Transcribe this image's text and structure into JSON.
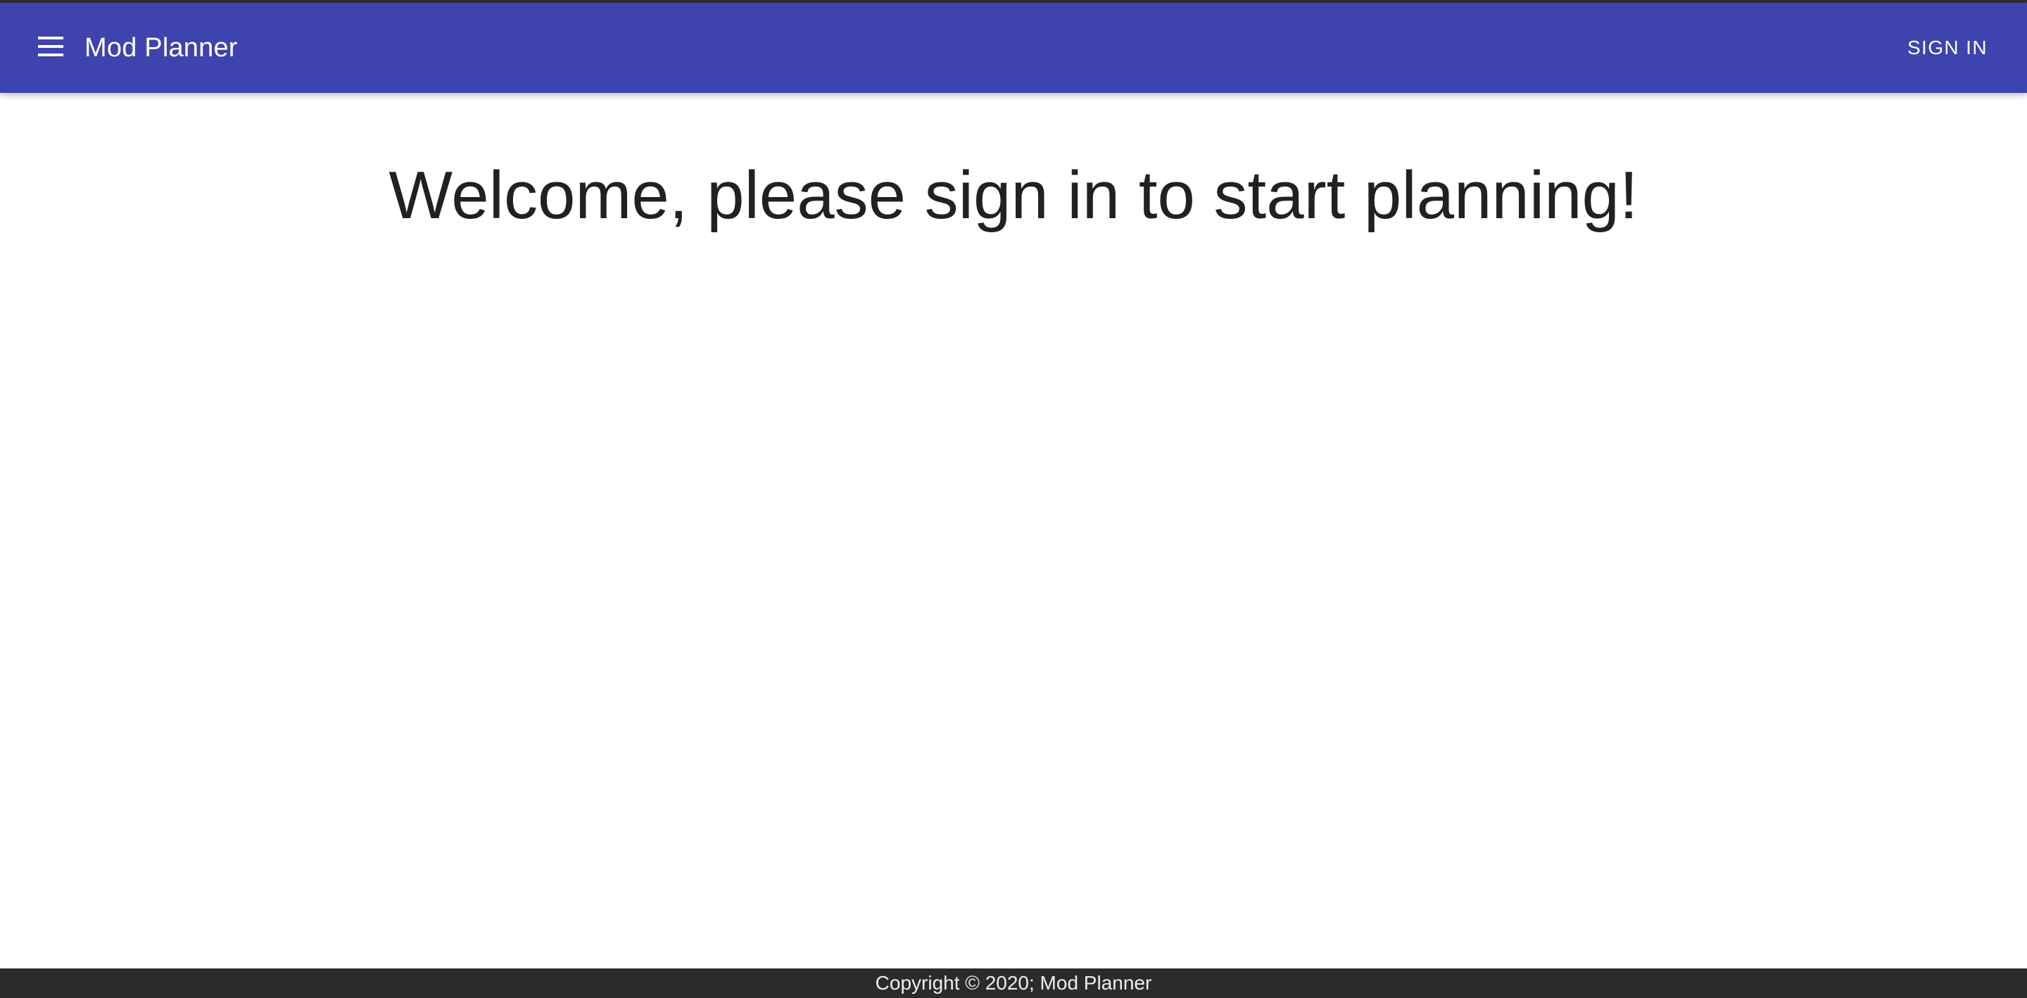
{
  "colors": {
    "app_bar": "#3f43ad",
    "top_strip": "#2f2f36",
    "background": "#ffffff",
    "heading_text": "#212121",
    "footer_background": "#2b2b2b",
    "footer_text": "#eeeeee"
  },
  "header": {
    "menu_icon": "hamburger-menu-icon",
    "title": "Mod Planner",
    "sign_in_label": "SIGN IN"
  },
  "main": {
    "welcome_text": "Welcome, please sign in to start planning!"
  },
  "footer": {
    "copyright_text": "Copyright © 2020; Mod Planner"
  }
}
